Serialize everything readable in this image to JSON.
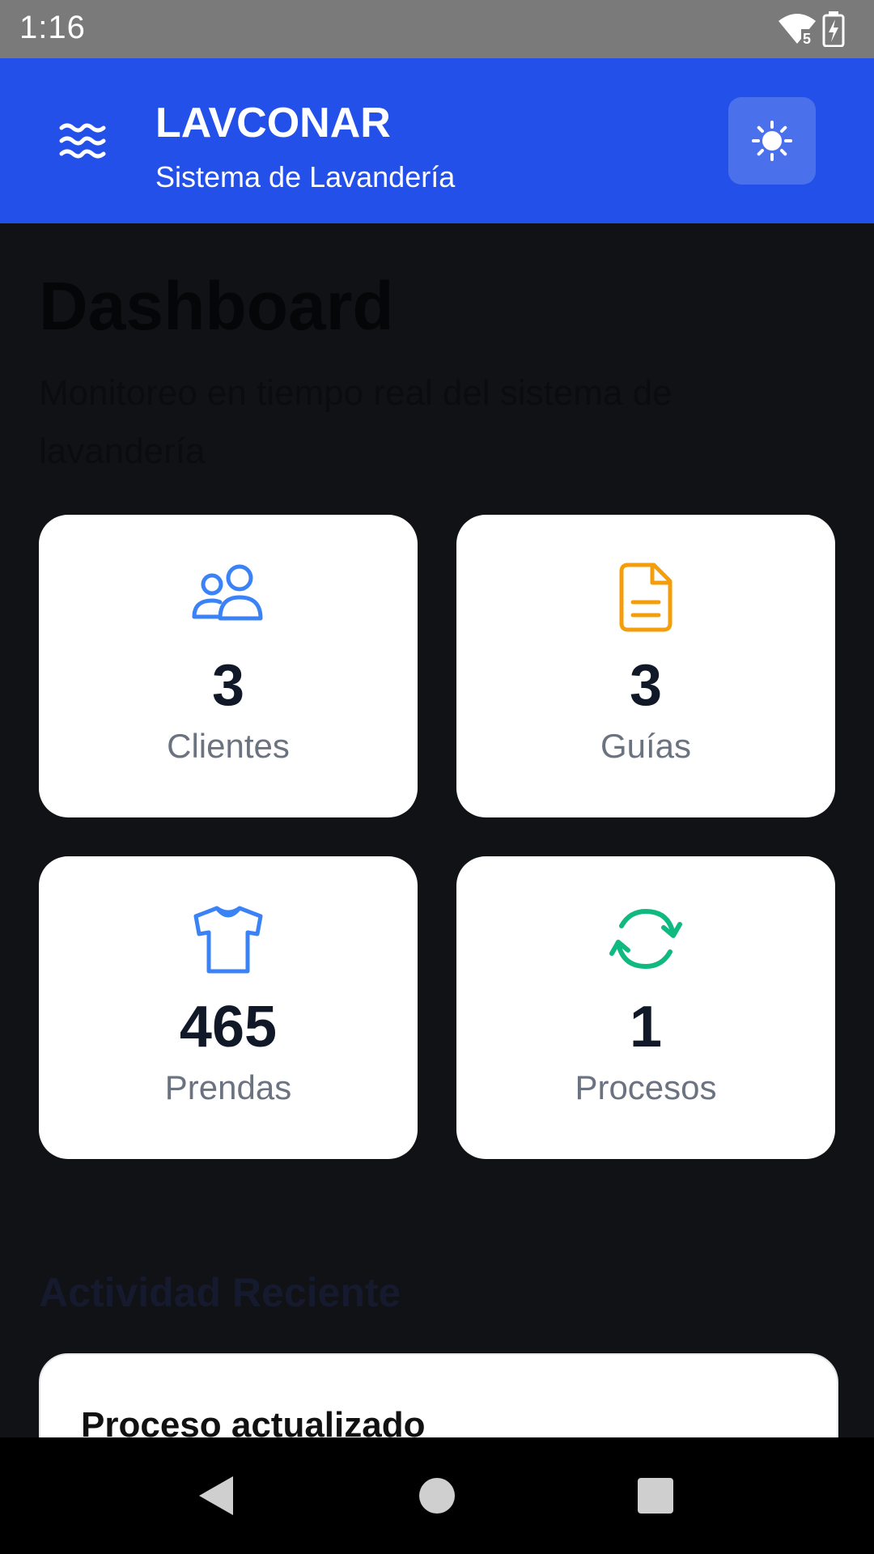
{
  "status_bar": {
    "time": "1:16",
    "signal_badge": "5",
    "icons": [
      "wifi-icon",
      "battery-charging-icon"
    ]
  },
  "app_bar": {
    "title": "LAVCONAR",
    "subtitle": "Sistema de Lavandería",
    "menu_icon": "waves-menu-icon",
    "theme_icon": "sun-icon",
    "color": "#2350e8"
  },
  "page": {
    "title": "Dashboard",
    "subtitle": "Monitoreo en tiempo real del sistema de lavandería"
  },
  "stats": [
    {
      "icon": "users-icon",
      "value": "3",
      "label": "Clientes",
      "color": "#3b82f6"
    },
    {
      "icon": "document-icon",
      "value": "3",
      "label": "Guías",
      "color": "#f59e0b"
    },
    {
      "icon": "shirt-icon",
      "value": "465",
      "label": "Prendas",
      "color": "#3b82f6"
    },
    {
      "icon": "refresh-icon",
      "value": "1",
      "label": "Procesos",
      "color": "#10b981"
    }
  ],
  "activity": {
    "section_title": "Actividad Reciente",
    "items": [
      {
        "title": "Proceso actualizado"
      }
    ]
  },
  "nav_bar": {
    "buttons": [
      "back-icon",
      "home-icon",
      "recents-icon"
    ]
  }
}
